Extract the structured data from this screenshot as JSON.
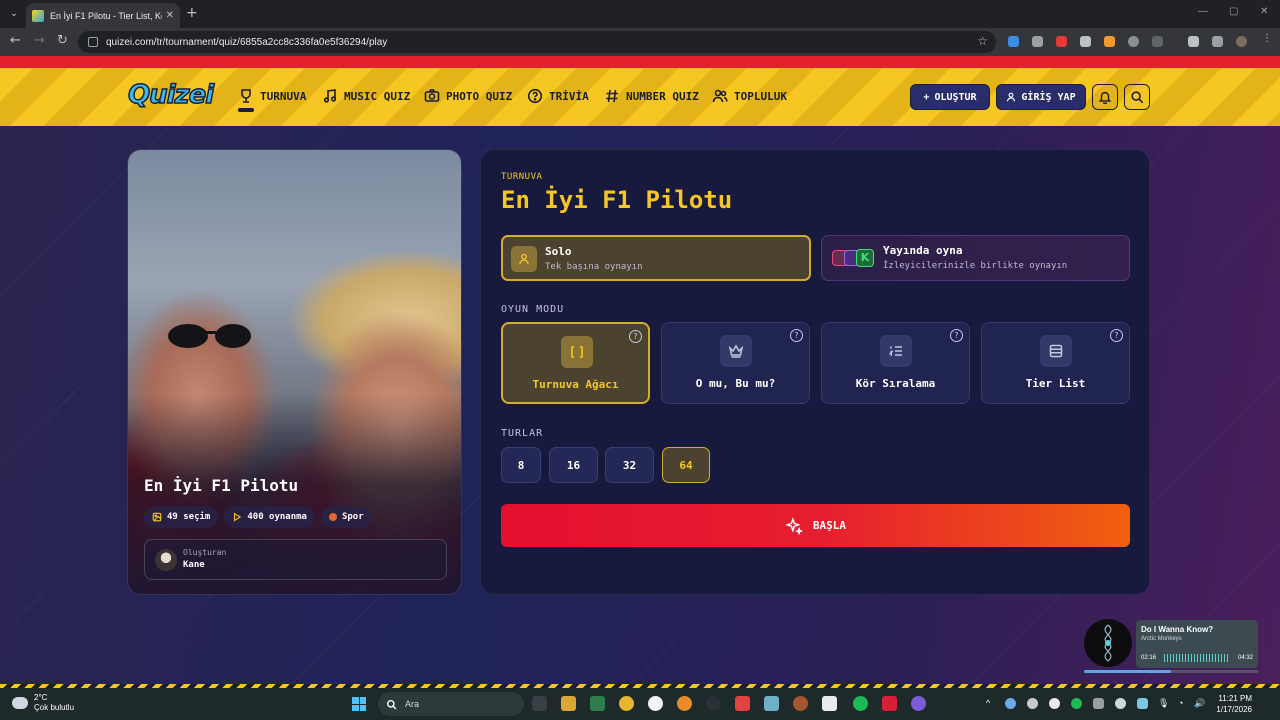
{
  "browser": {
    "tab_title": "En İyi F1 Pilotu - Tier List, Kör Sı",
    "url": "quizei.com/tr/tournament/quiz/6855a2cc8c336fa0e5f36294/play"
  },
  "header": {
    "logo": "Quizei",
    "nav": [
      {
        "label": "TURNUVA",
        "icon": "trophy-icon"
      },
      {
        "label": "MUSIC QUIZ",
        "icon": "music-note-icon"
      },
      {
        "label": "PHOTO QUIZ",
        "icon": "camera-icon"
      },
      {
        "label": "TRİVİA",
        "icon": "question-bubble-icon"
      },
      {
        "label": "NUMBER QUIZ",
        "icon": "hash-icon"
      },
      {
        "label": "TOPLULUK",
        "icon": "users-icon"
      }
    ],
    "create_label": "OLUŞTUR",
    "login_label": "GİRİŞ YAP"
  },
  "quiz_card": {
    "title": "En İyi F1 Pilotu",
    "choices": "49 seçim",
    "plays": "400 oynanma",
    "category": "Spor",
    "creator_label": "Oluşturan",
    "creator_name": "Kane"
  },
  "panel": {
    "kicker": "TURNUVA",
    "title": "En İyi F1 Pilotu",
    "play_options": [
      {
        "title": "Solo",
        "subtitle": "Tek başına oynayın",
        "selected": true
      },
      {
        "title": "Yayında oyna",
        "subtitle": "İzleyicilerinizle birlikte oynayın",
        "selected": false
      }
    ],
    "game_mode_label": "OYUN MODU",
    "modes": [
      {
        "label": "Turnuva Ağacı",
        "icon": "bracket-icon",
        "selected": true
      },
      {
        "label": "O mu, Bu mu?",
        "icon": "crown-icon",
        "selected": false
      },
      {
        "label": "Kör Sıralama",
        "icon": "ordered-list-icon",
        "selected": false
      },
      {
        "label": "Tier List",
        "icon": "table-list-icon",
        "selected": false
      }
    ],
    "rounds_label": "TURLAR",
    "rounds": [
      "8",
      "16",
      "32",
      "64"
    ],
    "selected_round": "64",
    "start_label": "BAŞLA"
  },
  "music_widget": {
    "title": "Do I Wanna Know?",
    "artist": "Arctic Monkeys",
    "elapsed": "02:16",
    "duration": "04:32",
    "progress": 0.5
  },
  "taskbar": {
    "temperature": "2°C",
    "weather": "Çok bulutlu",
    "search_placeholder": "Ara",
    "time": "11:21 PM",
    "date": "1/17/2026"
  },
  "colors": {
    "accent_yellow": "#f6c623",
    "header_red": "#e5202e",
    "start_gradient": [
      "#e5102f",
      "#f06010"
    ],
    "panel_bg": "#171a3d"
  }
}
